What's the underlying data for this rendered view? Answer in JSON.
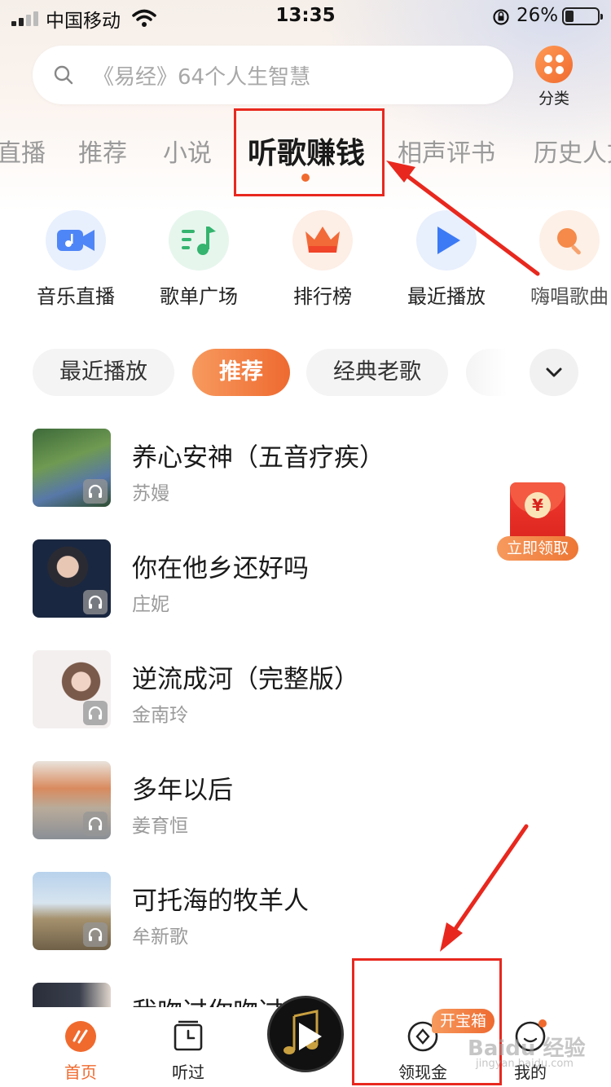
{
  "status_bar": {
    "carrier": "中国移动",
    "time": "13:35",
    "battery_percent": "26%",
    "battery_level": 0.26
  },
  "search": {
    "placeholder": "《易经》64个人生智慧",
    "category_label": "分类"
  },
  "tabs": [
    {
      "label": "直播"
    },
    {
      "label": "推荐"
    },
    {
      "label": "小说"
    },
    {
      "label": "听歌赚钱",
      "active": true
    },
    {
      "label": "相声评书"
    },
    {
      "label": "历史人文"
    }
  ],
  "quick_entries": [
    {
      "label": "音乐直播",
      "icon": "video-camera-icon",
      "color": "#4f86f7"
    },
    {
      "label": "歌单广场",
      "icon": "playlist-icon",
      "color": "#34b46e"
    },
    {
      "label": "排行榜",
      "icon": "crown-icon",
      "color": "#f0592e"
    },
    {
      "label": "最近播放",
      "icon": "play-icon",
      "color": "#3c7af5"
    },
    {
      "label": "嗨唱歌曲",
      "icon": "microphone-icon",
      "color": "#f58a4a"
    }
  ],
  "filters": {
    "items": [
      {
        "label": "最近播放"
      },
      {
        "label": "推荐",
        "active": true
      },
      {
        "label": "经典老歌"
      }
    ]
  },
  "songs": [
    {
      "title": "养心安神（五音疗疾）",
      "artist": "苏嫚"
    },
    {
      "title": "你在他乡还好吗",
      "artist": "庄妮"
    },
    {
      "title": "逆流成河（完整版）",
      "artist": "金南玲"
    },
    {
      "title": "多年以后",
      "artist": "姜育恒"
    },
    {
      "title": "可托海的牧羊人",
      "artist": "牟新歌"
    },
    {
      "title": "我吻过你吻过",
      "artist": ""
    }
  ],
  "red_packet": {
    "coin": "¥",
    "label": "立即领取"
  },
  "bottom_nav": {
    "home": "首页",
    "history": "听过",
    "earn": "领现金",
    "earn_badge": "开宝箱",
    "me": "我的"
  },
  "watermark": {
    "text": "Baidu 经验",
    "sub": "jingyan.baidu.com"
  },
  "colors": {
    "accent": "#f06a2e",
    "annotation": "#e8281e"
  }
}
